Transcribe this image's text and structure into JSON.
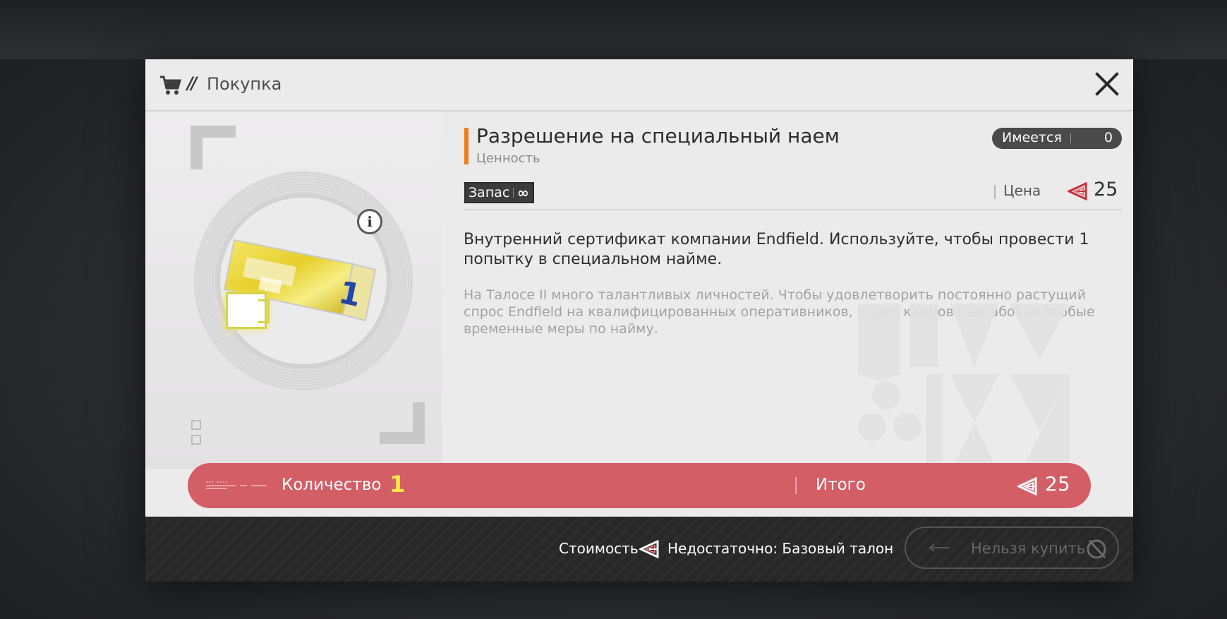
{
  "header": {
    "slashes": "//",
    "title": "Покупка",
    "icons": {
      "cart": "cart-icon",
      "close": "close-icon"
    }
  },
  "item": {
    "name": "Разрешение на специальный наем",
    "category": "Ценность",
    "owned_label": "Имеется",
    "owned_value": "0",
    "stock_label": "Запас",
    "stock_value": "∞",
    "price_label": "Цена",
    "price_value": "25",
    "description": "Внутренний сертификат компании Endfield. Используйте, чтобы провести 1 попытку в специальном найме.",
    "lore": "На Талосе II много талантливых личностей. Чтобы удовлетворить постоянно растущий спрос Endfield на квалифицированных оперативников, отдел кадров разработал особые временные меры по найму.",
    "info_symbol": "i",
    "ticket_number": "1"
  },
  "quantity": {
    "label": "Количество",
    "value": "1",
    "total_label": "Итого",
    "total_value": "25"
  },
  "footer": {
    "cost_label": "Стоимость",
    "insufficient_message": "Недостаточно: Базовый талон",
    "buy_button_label": "Нельзя купить"
  },
  "colors": {
    "accent": "#ee7e1a",
    "quantity_bar": "#d45e65",
    "quantity_value": "#ffe84a",
    "currency_icon": "#c8323c"
  }
}
